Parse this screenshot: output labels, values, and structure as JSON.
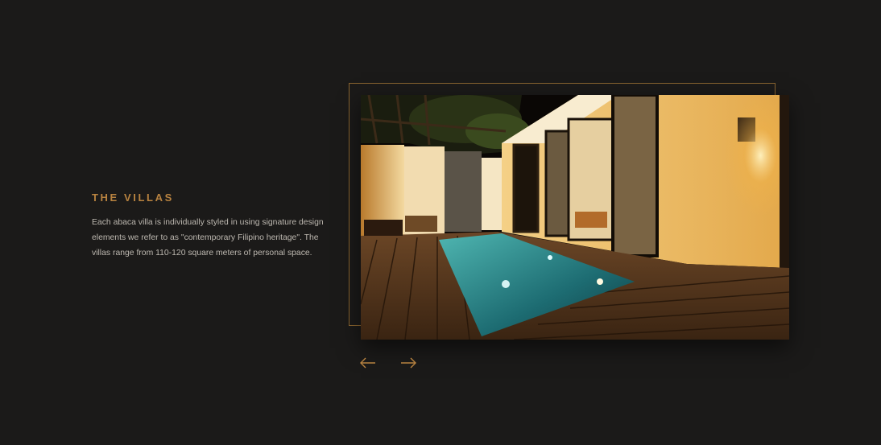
{
  "section": {
    "title": "THE VILLAS",
    "description": "Each abaca villa is individually styled in using signature design elements we refer to as \"contemporary Filipino heritage\". The villas range from 110-120 square meters of personal space."
  },
  "carousel": {
    "prev_icon": "arrow-left-icon",
    "next_icon": "arrow-right-icon",
    "accent_color": "#b88340"
  },
  "colors": {
    "background": "#1b1a19",
    "accent": "#b88340",
    "body_text": "#bdb8b0"
  }
}
